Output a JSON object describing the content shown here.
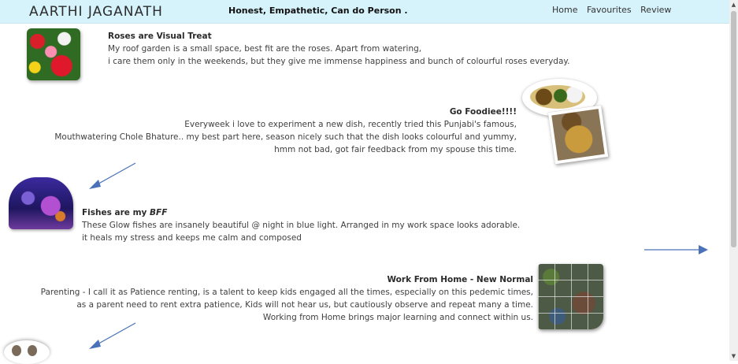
{
  "header": {
    "brand": "AARTHI JAGANATH",
    "tagline": "Honest, Empathetic, Can do Person .",
    "nav": [
      "Home",
      "Favourites",
      "Review"
    ]
  },
  "sections": [
    {
      "title": "Roses are Visual Treat",
      "lines": [
        "My roof garden is a small space, best fit are the roses. Apart from watering,",
        "i care them only in the weekends, but they give me immense happiness and bunch of colourful roses everyday."
      ]
    },
    {
      "title": "Go Foodiee!!!!",
      "lines": [
        "Everyweek i love to experiment a new dish, recently tried this Punjabi's famous,",
        "Mouthwatering Chole Bhature.. my best part here, season nicely such that the dish looks colourful and yummy,",
        "hmm not bad, got fair feedback from my spouse this time."
      ]
    },
    {
      "title_prefix": "Fishes are my ",
      "title_emphasis": "BFF",
      "lines": [
        "These Glow fishes are insanely beautiful @ night in blue light. Arranged in my work space looks adorable.",
        "it heals my stress and keeps me calm and composed"
      ]
    },
    {
      "title": "Work From Home - New Normal",
      "lines": [
        "Parenting - I call it as Patience renting, is a talent to keep kids engaged all the times, especially on this pedemic times,",
        "as a parent need to rent extra patience, Kids will not hear us, but cautiously observe and repeat many a time.",
        "Working from Home brings major learning and connect within us."
      ]
    }
  ],
  "colors": {
    "header_bg": "#d6f2fb",
    "arrow": "#4a72b8"
  },
  "icons": {
    "scroll_up": "▲",
    "scroll_down": "▼"
  }
}
